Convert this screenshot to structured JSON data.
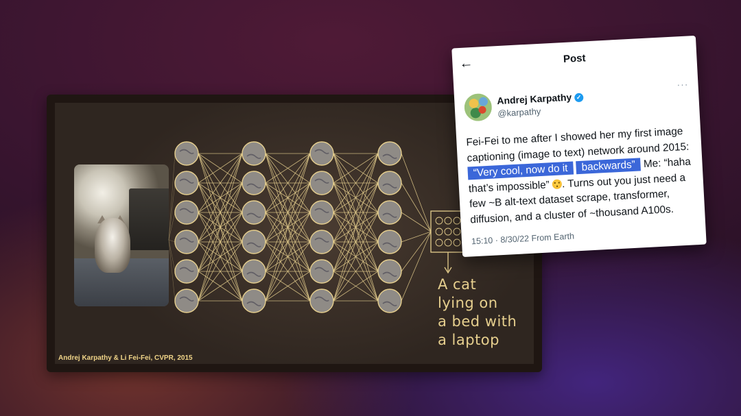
{
  "slide": {
    "caption_lines": [
      "A cat",
      "lying on",
      "a bed with",
      "a laptop"
    ],
    "credit": "Andrej Karpathy & Li Fei-Fei, CVPR, 2015",
    "accent_color": "#e6cf8e",
    "network_layers": 4,
    "nodes_per_layer": 6
  },
  "tweet": {
    "header_title": "Post",
    "back_icon": "arrow-left-icon",
    "author_name": "Andrej Karpathy",
    "verified_icon": "verified-badge-icon",
    "handle": "@karpathy",
    "more_icon": "more-dots-icon",
    "more_glyph": "···",
    "verified_glyph": "✓",
    "back_glyph": "←",
    "body_part1": "Fei-Fei to me after I showed her my first image captioning (image to text) network around 2015: ",
    "highlight_part1": "“Very cool, now do it",
    "highlight_part2": "backwards”",
    "body_part2": " Me: “haha that’s impossible” ",
    "emoji": "slightly-sad-face-icon",
    "body_part3": ". Turns out you just need a few ~B alt-text dataset scrape, transformer, diffusion, and a cluster of ~thousand A100s.",
    "meta": "15:10 · 8/30/22 From Earth",
    "highlight_color": "#3b67d9"
  }
}
